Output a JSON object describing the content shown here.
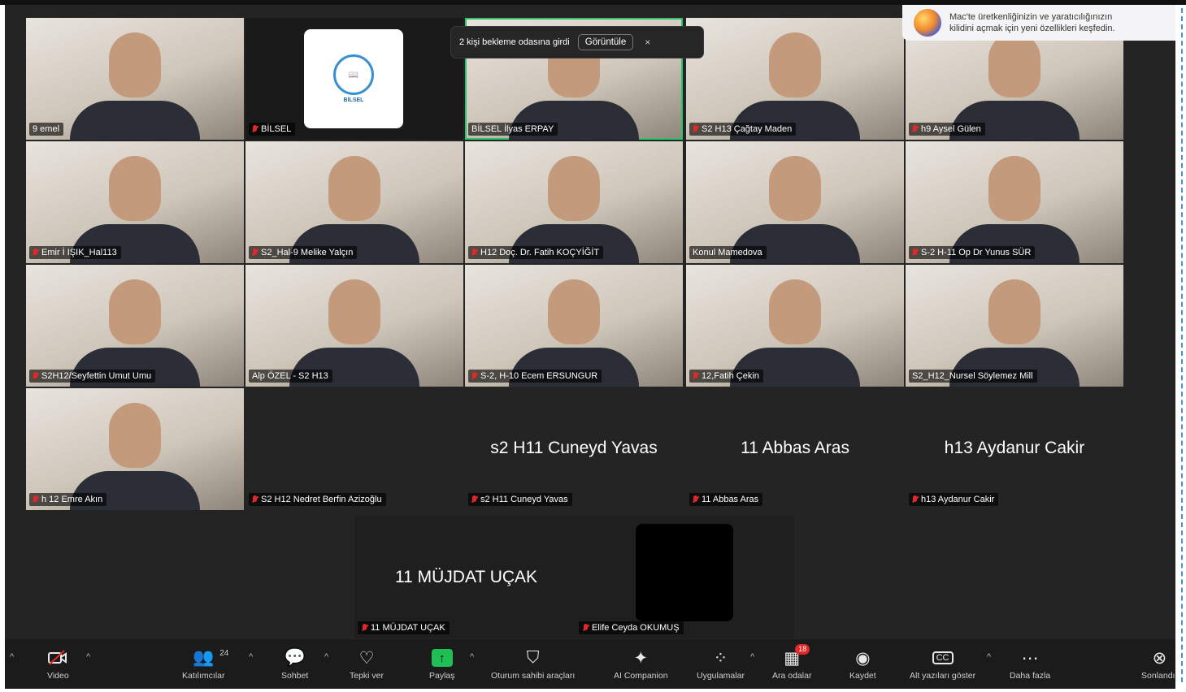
{
  "notice": {
    "text": "2 kişi bekleme odasına girdi",
    "button": "Görüntüle",
    "close": "×"
  },
  "promo": {
    "line1": "Mac'te üretkenliğinizin ve yaratıcılığınızın",
    "line2": "kilidini açmak için yeni özellikleri keşfedin."
  },
  "logo": {
    "letters": "BİLSEL",
    "small": "BİLSEL"
  },
  "tiles": [
    {
      "name": "9 emel"
    },
    {
      "name": "BİLSEL"
    },
    {
      "name": "BİLSEL İlyas ERPAY"
    },
    {
      "name": "S2 H13 Çağtay Maden"
    },
    {
      "name": "h9 Aysel Gülen"
    },
    {
      "name": "Emir İ IŞIK_Hal113"
    },
    {
      "name": "S2_Hal-9 Melike Yalçın"
    },
    {
      "name": "H12 Doç. Dr. Fatih KOÇYİĞİT"
    },
    {
      "name": "Konul Mamedova"
    },
    {
      "name": "S-2 H-11 Op Dr Yunus SÜR"
    },
    {
      "name": "S2H12/Seyfettin Umut Umu"
    },
    {
      "name": "Alp ÖZEL - S2 H13"
    },
    {
      "name": "S-2, H-10 Ecem ERSUNGUR"
    },
    {
      "name": "12,Fatih Çekin"
    },
    {
      "name": "S2_H12_Nursel Söylemez Mill"
    },
    {
      "name": "h 12 Emre Akın"
    },
    {
      "name": "S2 H12 Nedret Berfin Azizoğlu"
    },
    {
      "name": "s2 H11 Cuneyd Yavas",
      "big": "s2 H11 Cuneyd Yavas"
    },
    {
      "name": "11 Abbas Aras",
      "big": "11 Abbas Aras"
    },
    {
      "name": "h13 Aydanur Cakir",
      "big": "h13 Aydanur Cakir"
    }
  ],
  "bottom": {
    "big": "11 MÜJDAT UÇAK",
    "name1": "11 MÜJDAT UÇAK",
    "name2": "Elife Ceyda OKUMUŞ"
  },
  "toolbar": {
    "video": "Video",
    "participants": "Katılımcılar",
    "participants_count": "24",
    "chat": "Sohbet",
    "react": "Tepki ver",
    "share": "Paylaş",
    "host_tools": "Oturum sahibi araçları",
    "ai": "AI Companion",
    "apps": "Uygulamalar",
    "breakout": "Ara odalar",
    "breakout_badge": "18",
    "record": "Kaydet",
    "captions": "Alt yazıları göster",
    "more": "Daha fazla",
    "end": "Sonlandır"
  },
  "colors": {
    "active_border": "#2ec36b",
    "end": "#e02828",
    "share": "#1fbf55"
  }
}
